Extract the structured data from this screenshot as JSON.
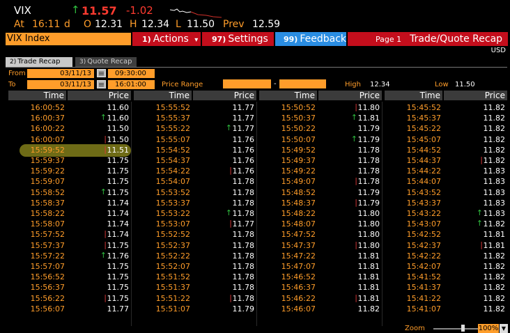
{
  "quote": {
    "symbol": "VIX",
    "arrow": "↑",
    "last": "11.57",
    "change": "-1.02",
    "at_label": "At",
    "time": "16:11",
    "d": "d",
    "o_label": "O",
    "open": "12.31",
    "h_label": "H",
    "high": "12.34",
    "l_label": "L",
    "low": "11.50",
    "prev_label": "Prev",
    "prev": "12.59"
  },
  "toolbar": {
    "title": "VIX Index",
    "actions_num": "1)",
    "actions_label": "Actions",
    "actions_caret": "▾",
    "settings_num": "97)",
    "settings_label": "Settings",
    "feedback_num": "99)",
    "feedback_label": "Feedback",
    "page_label": "Page 1",
    "page_title": "Trade/Quote Recap",
    "currency": "USD"
  },
  "tabs": [
    {
      "num": "2)",
      "label": "Trade Recap"
    },
    {
      "num": "3)",
      "label": "Quote Recap"
    }
  ],
  "filter": {
    "from_label": "From",
    "from_date": "03/11/13",
    "from_time": "09:30:00",
    "to_label": "To",
    "to_date": "03/11/13",
    "to_time": "16:01:00",
    "price_range_label": "Price Range",
    "range_min": "",
    "range_dash": "-",
    "range_max": "",
    "high_label": "High",
    "high_value": "12.34",
    "low_label": "Low",
    "low_value": "11.50"
  },
  "table": {
    "time_header": "Time",
    "price_header": "Price",
    "columns": [
      [
        {
          "time": "16:00:52",
          "price": "11.60",
          "dir": ""
        },
        {
          "time": "16:00:37",
          "price": "11.60",
          "dir": "up"
        },
        {
          "time": "16:00:22",
          "price": "11.50",
          "dir": ""
        },
        {
          "time": "16:00:07",
          "price": "11.50",
          "dir": "dn"
        },
        {
          "time": "15:59:52",
          "price": "11.51",
          "dir": "dn"
        },
        {
          "time": "15:59:37",
          "price": "11.75",
          "dir": ""
        },
        {
          "time": "15:59:22",
          "price": "11.75",
          "dir": ""
        },
        {
          "time": "15:59:07",
          "price": "11.75",
          "dir": ""
        },
        {
          "time": "15:58:52",
          "price": "11.75",
          "dir": "up"
        },
        {
          "time": "15:58:37",
          "price": "11.74",
          "dir": ""
        },
        {
          "time": "15:58:22",
          "price": "11.74",
          "dir": ""
        },
        {
          "time": "15:58:07",
          "price": "11.74",
          "dir": ""
        },
        {
          "time": "15:57:52",
          "price": "11.74",
          "dir": "dn"
        },
        {
          "time": "15:57:37",
          "price": "11.75",
          "dir": "dn"
        },
        {
          "time": "15:57:22",
          "price": "11.76",
          "dir": "up"
        },
        {
          "time": "15:57:07",
          "price": "11.75",
          "dir": ""
        },
        {
          "time": "15:56:52",
          "price": "11.75",
          "dir": ""
        },
        {
          "time": "15:56:37",
          "price": "11.75",
          "dir": ""
        },
        {
          "time": "15:56:22",
          "price": "11.75",
          "dir": "dn"
        },
        {
          "time": "15:56:07",
          "price": "11.77",
          "dir": ""
        }
      ],
      [
        {
          "time": "15:55:52",
          "price": "11.77",
          "dir": ""
        },
        {
          "time": "15:55:37",
          "price": "11.77",
          "dir": ""
        },
        {
          "time": "15:55:22",
          "price": "11.77",
          "dir": "up"
        },
        {
          "time": "15:55:07",
          "price": "11.76",
          "dir": ""
        },
        {
          "time": "15:54:52",
          "price": "11.76",
          "dir": ""
        },
        {
          "time": "15:54:37",
          "price": "11.76",
          "dir": ""
        },
        {
          "time": "15:54:22",
          "price": "11.76",
          "dir": "dn"
        },
        {
          "time": "15:54:07",
          "price": "11.78",
          "dir": ""
        },
        {
          "time": "15:53:52",
          "price": "11.78",
          "dir": ""
        },
        {
          "time": "15:53:37",
          "price": "11.78",
          "dir": ""
        },
        {
          "time": "15:53:22",
          "price": "11.78",
          "dir": "up"
        },
        {
          "time": "15:53:07",
          "price": "11.77",
          "dir": "dn"
        },
        {
          "time": "15:52:52",
          "price": "11.78",
          "dir": ""
        },
        {
          "time": "15:52:37",
          "price": "11.78",
          "dir": ""
        },
        {
          "time": "15:52:22",
          "price": "11.78",
          "dir": ""
        },
        {
          "time": "15:52:07",
          "price": "11.78",
          "dir": ""
        },
        {
          "time": "15:51:52",
          "price": "11.78",
          "dir": ""
        },
        {
          "time": "15:51:37",
          "price": "11.78",
          "dir": ""
        },
        {
          "time": "15:51:22",
          "price": "11.78",
          "dir": "dn"
        },
        {
          "time": "15:51:07",
          "price": "11.79",
          "dir": ""
        }
      ],
      [
        {
          "time": "15:50:52",
          "price": "11.80",
          "dir": "dn"
        },
        {
          "time": "15:50:37",
          "price": "11.81",
          "dir": "up"
        },
        {
          "time": "15:50:22",
          "price": "11.79",
          "dir": ""
        },
        {
          "time": "15:50:07",
          "price": "11.79",
          "dir": "up"
        },
        {
          "time": "15:49:52",
          "price": "11.78",
          "dir": ""
        },
        {
          "time": "15:49:37",
          "price": "11.78",
          "dir": ""
        },
        {
          "time": "15:49:22",
          "price": "11.78",
          "dir": ""
        },
        {
          "time": "15:49:07",
          "price": "11.78",
          "dir": "dn"
        },
        {
          "time": "15:48:52",
          "price": "11.79",
          "dir": ""
        },
        {
          "time": "15:48:37",
          "price": "11.79",
          "dir": "dn"
        },
        {
          "time": "15:48:22",
          "price": "11.80",
          "dir": ""
        },
        {
          "time": "15:48:07",
          "price": "11.80",
          "dir": ""
        },
        {
          "time": "15:47:52",
          "price": "11.80",
          "dir": ""
        },
        {
          "time": "15:47:37",
          "price": "11.80",
          "dir": "dn"
        },
        {
          "time": "15:47:22",
          "price": "11.81",
          "dir": ""
        },
        {
          "time": "15:47:07",
          "price": "11.81",
          "dir": ""
        },
        {
          "time": "15:46:52",
          "price": "11.81",
          "dir": ""
        },
        {
          "time": "15:46:37",
          "price": "11.81",
          "dir": ""
        },
        {
          "time": "15:46:22",
          "price": "11.81",
          "dir": "dn"
        },
        {
          "time": "15:46:07",
          "price": "11.82",
          "dir": ""
        }
      ],
      [
        {
          "time": "15:45:52",
          "price": "11.82",
          "dir": ""
        },
        {
          "time": "15:45:37",
          "price": "11.82",
          "dir": ""
        },
        {
          "time": "15:45:22",
          "price": "11.82",
          "dir": ""
        },
        {
          "time": "15:45:07",
          "price": "11.82",
          "dir": ""
        },
        {
          "time": "15:44:52",
          "price": "11.82",
          "dir": ""
        },
        {
          "time": "15:44:37",
          "price": "11.82",
          "dir": "dn"
        },
        {
          "time": "15:44:22",
          "price": "11.83",
          "dir": ""
        },
        {
          "time": "15:44:07",
          "price": "11.83",
          "dir": ""
        },
        {
          "time": "15:43:52",
          "price": "11.83",
          "dir": ""
        },
        {
          "time": "15:43:37",
          "price": "11.83",
          "dir": ""
        },
        {
          "time": "15:43:22",
          "price": "11.83",
          "dir": "up"
        },
        {
          "time": "15:43:07",
          "price": "11.82",
          "dir": "up"
        },
        {
          "time": "15:42:52",
          "price": "11.81",
          "dir": ""
        },
        {
          "time": "15:42:37",
          "price": "11.81",
          "dir": "dn"
        },
        {
          "time": "15:42:22",
          "price": "11.82",
          "dir": ""
        },
        {
          "time": "15:42:07",
          "price": "11.82",
          "dir": ""
        },
        {
          "time": "15:41:52",
          "price": "11.82",
          "dir": ""
        },
        {
          "time": "15:41:37",
          "price": "11.82",
          "dir": ""
        },
        {
          "time": "15:41:22",
          "price": "11.82",
          "dir": ""
        },
        {
          "time": "15:41:07",
          "price": "11.82",
          "dir": ""
        }
      ]
    ]
  },
  "zoom": {
    "label": "Zoom",
    "value": "100%",
    "level_percent": 100
  }
}
